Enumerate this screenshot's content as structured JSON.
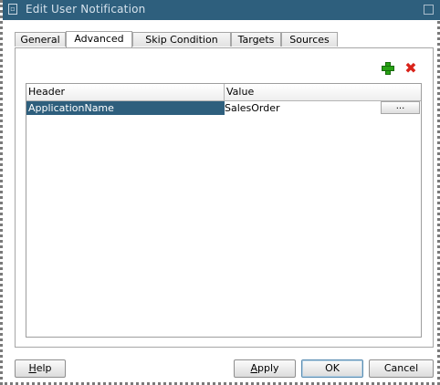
{
  "window": {
    "title": "Edit User Notification"
  },
  "tabs": [
    {
      "label": "General"
    },
    {
      "label": "Advanced"
    },
    {
      "label": "Skip Condition"
    },
    {
      "label": "Targets"
    },
    {
      "label": "Sources"
    }
  ],
  "active_tab": "Advanced",
  "toolbar": {
    "add_icon": "add-icon",
    "delete_icon": "delete-icon",
    "delete_glyph": "✖"
  },
  "table": {
    "columns": [
      "Header",
      "Value"
    ],
    "rows": [
      {
        "header": "ApplicationName",
        "value": "SalesOrder",
        "button": "..."
      }
    ],
    "selected_color": "#2e5f7d"
  },
  "buttons": {
    "help": {
      "mnemonic": "H",
      "rest": "elp"
    },
    "apply": {
      "mnemonic": "A",
      "rest": "pply"
    },
    "ok": "OK",
    "cancel": "Cancel"
  }
}
